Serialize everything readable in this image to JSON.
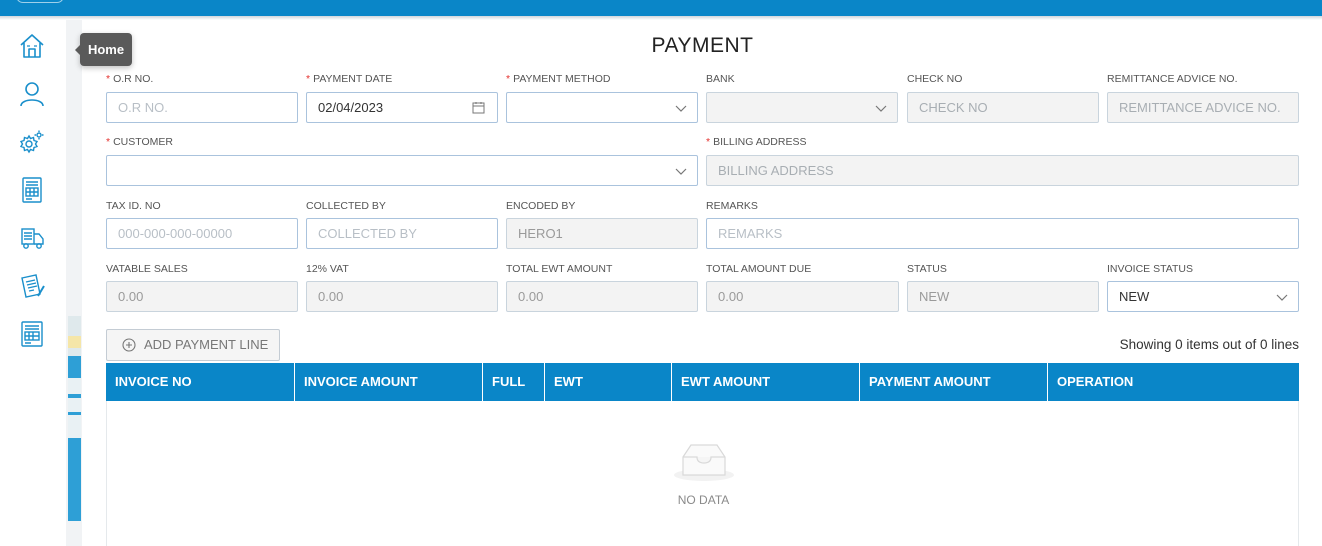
{
  "tooltip": "Home",
  "page_title": "PAYMENT",
  "sidebar_icons": [
    "home-icon",
    "user-icon",
    "gear-icon",
    "invoice-icon",
    "truck-icon",
    "document-pen-icon",
    "report-icon"
  ],
  "form": {
    "or_no": {
      "label": "O.R NO.",
      "placeholder": "O.R NO.",
      "required": true
    },
    "payment_date": {
      "label": "PAYMENT DATE",
      "value": "02/04/2023",
      "required": true
    },
    "payment_method": {
      "label": "PAYMENT METHOD",
      "value": "",
      "required": true
    },
    "bank": {
      "label": "BANK",
      "value": ""
    },
    "check_no": {
      "label": "CHECK NO",
      "placeholder": "CHECK NO"
    },
    "remittance_advice_no": {
      "label": "REMITTANCE ADVICE NO.",
      "placeholder": "REMITTANCE ADVICE NO."
    },
    "customer": {
      "label": "CUSTOMER",
      "value": "",
      "required": true
    },
    "billing_address": {
      "label": "BILLING ADDRESS",
      "placeholder": "BILLING ADDRESS",
      "required": true
    },
    "tax_id_no": {
      "label": "TAX ID. NO",
      "placeholder": "000-000-000-00000"
    },
    "collected_by": {
      "label": "COLLECTED BY",
      "placeholder": "COLLECTED BY"
    },
    "encoded_by": {
      "label": "ENCODED BY",
      "value": "HERO1"
    },
    "remarks": {
      "label": "REMARKS",
      "placeholder": "REMARKS"
    },
    "vatable_sales": {
      "label": "VATABLE SALES",
      "value": "0.00"
    },
    "vat_12": {
      "label": "12% VAT",
      "value": "0.00"
    },
    "total_ewt_amount": {
      "label": "TOTAL EWT AMOUNT",
      "value": "0.00"
    },
    "total_amount_due": {
      "label": "TOTAL AMOUNT DUE",
      "value": "0.00"
    },
    "status": {
      "label": "STATUS",
      "value": "NEW"
    },
    "invoice_status": {
      "label": "INVOICE STATUS",
      "value": "NEW"
    }
  },
  "add_payment_line_label": "ADD PAYMENT LINE",
  "showing_text": "Showing 0 items out of 0 lines",
  "table": {
    "columns": [
      "INVOICE NO",
      "INVOICE AMOUNT",
      "FULL",
      "EWT",
      "EWT AMOUNT",
      "PAYMENT AMOUNT",
      "OPERATION"
    ],
    "rows": [],
    "empty_text": "NO DATA"
  },
  "colors": {
    "accent": "#0a86c8",
    "required_star": "#e5322f"
  }
}
